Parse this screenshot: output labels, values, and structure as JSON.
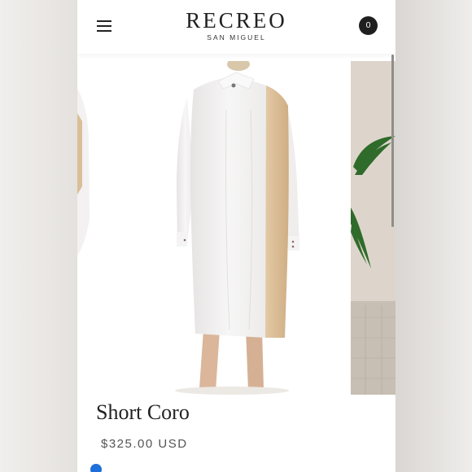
{
  "header": {
    "logo_main": "RECREO",
    "logo_sub": "SAN MIGUEL",
    "cart_count": "0"
  },
  "product": {
    "title": "Short Coro",
    "price": "$325.00 USD"
  },
  "colors": {
    "cart_badge": "#1f1f1f",
    "accent_dot": "#1e6fd9",
    "dress_white": "#f4f2f2",
    "dress_beige": "#dcc09a"
  },
  "icons": {
    "menu": "hamburger-icon",
    "cart": "cart-badge"
  }
}
